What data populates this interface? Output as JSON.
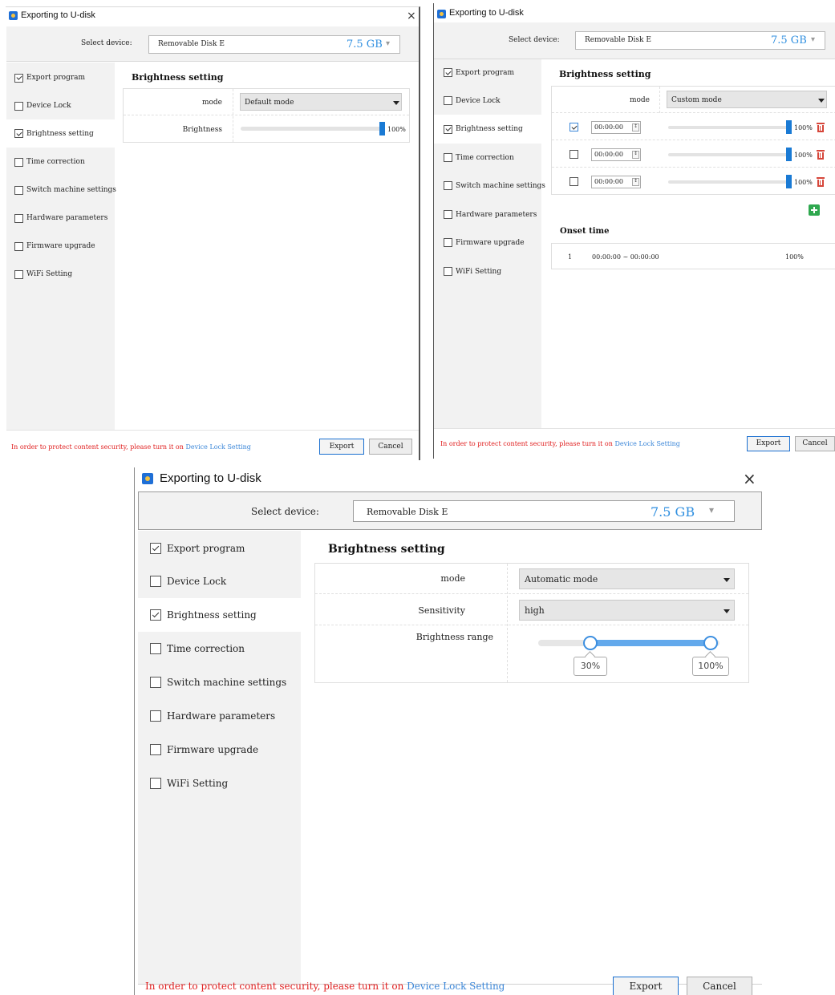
{
  "window": {
    "title": "Exporting to U-disk",
    "close_label": "×"
  },
  "device": {
    "label": "Select device:",
    "name": "Removable Disk E",
    "size": "7.5 GB",
    "caret": "▾"
  },
  "sidebar": {
    "items": [
      {
        "label": "Export program",
        "checked": true
      },
      {
        "label": "Device Lock",
        "checked": false
      },
      {
        "label": "Brightness setting",
        "checked": true
      },
      {
        "label": "Time correction",
        "checked": false
      },
      {
        "label": "Switch machine settings",
        "checked": false
      },
      {
        "label": "Hardware parameters",
        "checked": false
      },
      {
        "label": "Firmware upgrade",
        "checked": false
      },
      {
        "label": "WiFi Setting",
        "checked": false
      }
    ]
  },
  "section_title": "Brightness setting",
  "footer": {
    "warning_prefix": "In order to protect content security, please turn it on ",
    "warning_link": "Device Lock Setting",
    "export_label": "Export",
    "cancel_label": "Cancel"
  },
  "panel_default": {
    "mode_label": "mode",
    "mode_value": "Default mode",
    "brightness_label": "Brightness",
    "brightness_value": 100,
    "brightness_text": "100%"
  },
  "panel_custom": {
    "mode_label": "mode",
    "mode_value": "Custom mode",
    "rows": [
      {
        "checked": true,
        "time": "00:00:00",
        "brightness": 100,
        "brightness_text": "100%"
      },
      {
        "checked": false,
        "time": "00:00:00",
        "brightness": 100,
        "brightness_text": "100%"
      },
      {
        "checked": false,
        "time": "00:00:00",
        "brightness": 100,
        "brightness_text": "100%"
      }
    ],
    "onset_title": "Onset time",
    "onset_rows": [
      {
        "index": "1",
        "range": "00:00:00 ~ 00:00:00",
        "brightness": "100%"
      }
    ]
  },
  "panel_auto": {
    "mode_label": "mode",
    "mode_value": "Automatic mode",
    "sensitivity_label": "Sensitivity",
    "sensitivity_value": "high",
    "range_label": "Brightness range",
    "range_min": 30,
    "range_max": 100,
    "range_min_text": "30%",
    "range_max_text": "100%"
  },
  "colors": {
    "accent": "#1a7ad4",
    "size_text": "#2f8fe0",
    "warning": "#e02020",
    "link": "#3a86d8",
    "delete": "#d6463a",
    "add": "#2fa84f"
  }
}
